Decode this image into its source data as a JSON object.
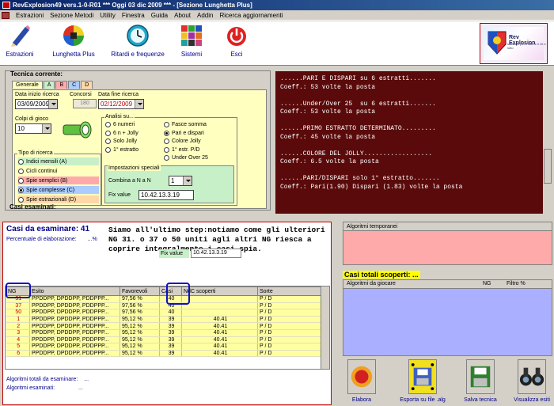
{
  "window": {
    "title": "RevExplosion49 vers.1-0-R01  ***  Oggi 03 dic 2009  ***  - [Sezione Lunghetta Plus]"
  },
  "menu": [
    "Estrazioni",
    "Sezione Metodi",
    "Utility",
    "Finestra",
    "Guida",
    "About",
    "Addin",
    "Ricerca aggiornamenti"
  ],
  "toolbar": {
    "buttons": [
      {
        "label": "Estrazioni",
        "icon": "pencil-icon"
      },
      {
        "label": "Lunghetta Plus",
        "icon": "color-ball-icon"
      },
      {
        "label": "Ritardi e frequenze",
        "icon": "clock-icon"
      },
      {
        "label": "Sistemi",
        "icon": "grid-icon"
      },
      {
        "label": "Esci",
        "icon": "power-icon"
      }
    ],
    "logo": {
      "name": "Rev Explosion",
      "tagline": "software per il lotto e il 10 e lotto"
    }
  },
  "tecnica": {
    "title": "Tecnica corrente:",
    "tabs": [
      "Generale",
      "A",
      "B",
      "C",
      "D"
    ],
    "data_inizio_label": "Data inizio ricerca",
    "data_inizio": "03/09/2009",
    "concorsi_label": "Concorsi",
    "concorsi": "180",
    "data_fine_label": "Data fine ricerca",
    "data_fine": "02/12/2009",
    "colpi_label": "Colpi di gioco",
    "colpi": "10",
    "tipo_label": "Tipo di ricerca",
    "tipo": [
      {
        "label": "Indici mensili (A)",
        "selected": false,
        "bg": "#c8f0c8"
      },
      {
        "label": "Cicli continui",
        "selected": false,
        "bg": "#ffffc0"
      },
      {
        "label": "Spie semplici (B)",
        "selected": false,
        "bg": "#ffaaaa"
      },
      {
        "label": "Spie complesse (C)",
        "selected": true,
        "bg": "#aaccff"
      },
      {
        "label": "Spie estrazionali (D)",
        "selected": false,
        "bg": "#ffd8a8"
      }
    ],
    "analisi_label": "Analisi su...",
    "analisi": [
      {
        "label": "6 numeri",
        "selected": false
      },
      {
        "label": "Fasce somma",
        "selected": false
      },
      {
        "label": "6 n + Jolly",
        "selected": false
      },
      {
        "label": "Pari e dispari",
        "selected": true
      },
      {
        "label": "Solo Jolly",
        "selected": false
      },
      {
        "label": "Colore Jolly",
        "selected": false
      },
      {
        "label": "1° estratto",
        "selected": false
      },
      {
        "label": "1° estr. P/D",
        "selected": false
      },
      {
        "label": "",
        "selected": false
      },
      {
        "label": "Under Over 25",
        "selected": false
      }
    ],
    "impostazioni_label": "Impostazioni speciali",
    "combina_label": "Combina a N a N",
    "combina": "1",
    "fix_label": "Fix value",
    "fix_value": "10.42.13.3.19",
    "casi_esaminati": "Casi esaminati:"
  },
  "output": {
    "lines": [
      "......PARI E DISPARI su 6 estratti.......",
      "Coeff.: 53 volte la posta",
      "",
      "......Under/Over 25  su 6 estratti.......",
      "Coeff.: 53 volte la posta",
      "",
      "......PRIMO ESTRATTO DETERMINATO.........",
      "Coeff.: 45 volte la posta",
      "",
      "......COLORE DEL JOLLY..................",
      "Coeff.: 6.5 volte la posta",
      "",
      "......PARI/DISPARI solo 1° estratto.......",
      "Coeff.: Pari(1.90) Dispari (1.83) volte la posta"
    ]
  },
  "casi": {
    "title": "Casi da esaminare: 41",
    "perc_label": "Percentuale di elaborazione:",
    "perc_value": "...%",
    "message": "Siamo all'ultimo step:notiamo come gli ulteriori NG 31. o 37 o 50 uniti agli altri NG              riesca a coprire integralmente i casi spia.",
    "fix_label": "Fix value",
    "fix_value": "10.42.13.3.19",
    "columns": [
      "NG",
      "Esito",
      "Favorevoli",
      "Casi",
      "NdC scoperti",
      "Sorte"
    ],
    "rows": [
      [
        "31",
        "PPDDPP, DPDDPP, PDDPPP...",
        "97,56 %",
        "40",
        "",
        "P / D"
      ],
      [
        "37",
        "PPDDPP, DPDDPP, PDDPPP...",
        "97,56 %",
        "40",
        "",
        "P / D"
      ],
      [
        "50",
        "PPDDPP, DPDDPP, PDDPPP...",
        "97,56 %",
        "40",
        "",
        "P / D"
      ],
      [
        "1",
        "PPDDPP, DPDDPP, PDDPPP...",
        "95,12 %",
        "39",
        "40.41",
        "P / D"
      ],
      [
        "2",
        "PPDDPP, DPDDPP, PDDPPP...",
        "95,12 %",
        "39",
        "40.41",
        "P / D"
      ],
      [
        "3",
        "PPDDPP, DPDDPP, PDDPPP...",
        "95,12 %",
        "39",
        "40.41",
        "P / D"
      ],
      [
        "4",
        "PPDDPP, DPDDPP, PDDPPP...",
        "95,12 %",
        "39",
        "40.41",
        "P / D"
      ],
      [
        "5",
        "PPDDPP, DPDDPP, PDDPPP...",
        "95,12 %",
        "39",
        "40.41",
        "P / D"
      ],
      [
        "6",
        "PPDDPP, DPDDPP, PDDPPP...",
        "95,12 %",
        "39",
        "40.41",
        "P / D"
      ]
    ],
    "totali_label": "Algoritmi totali da esaminare:",
    "totali_value": "...",
    "esaminati_label": "Algoritmi esaminati:",
    "esaminati_value": "..."
  },
  "algoritmi_temporanei": {
    "header": "Algoritmi temporanei"
  },
  "casi_totali": {
    "label": "Casi totali scoperti: ..."
  },
  "algoritmi_giocare": {
    "columns": [
      "Algoritmi da giocare",
      "NG",
      "Filtro %"
    ]
  },
  "actions": [
    {
      "label": "Elabora",
      "icon": "record-icon"
    },
    {
      "label": "Esporta su file .alg",
      "icon": "floppy-export-icon"
    },
    {
      "label": "Salva tecnica",
      "icon": "floppy-icon"
    },
    {
      "label": "Visualizza esiti",
      "icon": "binoculars-icon"
    }
  ]
}
